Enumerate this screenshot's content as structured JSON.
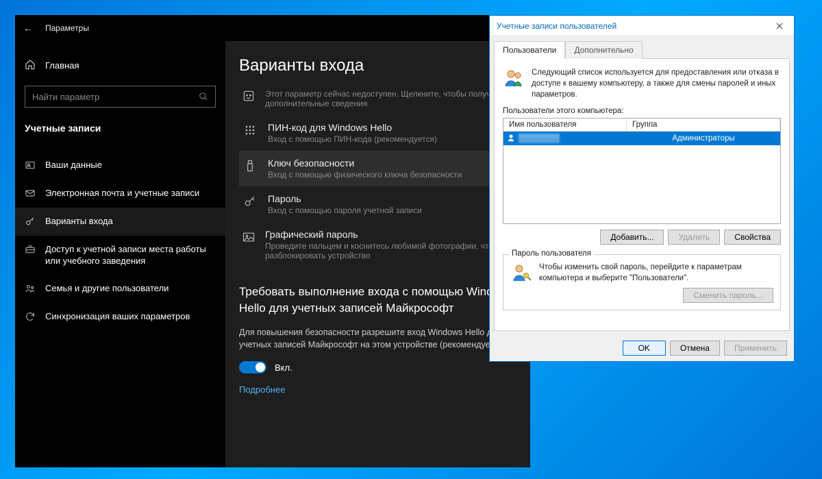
{
  "settings": {
    "title": "Параметры",
    "home": "Главная",
    "search_placeholder": "Найти параметр",
    "group": "Учетные записи",
    "items": [
      {
        "label": "Ваши данные",
        "icon": "user-card-icon"
      },
      {
        "label": "Электронная почта и учетные записи",
        "icon": "mail-icon"
      },
      {
        "label": "Варианты входа",
        "icon": "key-icon",
        "selected": true
      },
      {
        "label": "Доступ к учетной записи места работы или учебного заведения",
        "icon": "briefcase-icon"
      },
      {
        "label": "Семья и другие пользователи",
        "icon": "family-icon"
      },
      {
        "label": "Синхронизация ваших параметров",
        "icon": "sync-icon"
      }
    ]
  },
  "main": {
    "title": "Варианты входа",
    "topnote_desc": "Этот параметр сейчас недоступен. Щелкните, чтобы получить дополнительные сведения",
    "options": [
      {
        "title": "ПИН-код для Windows Hello",
        "desc": "Вход с помощью ПИН-кода (рекомендуется)",
        "icon": "pin-grid-icon"
      },
      {
        "title": "Ключ безопасности",
        "desc": "Вход с помощью физического ключа безопасности",
        "icon": "usb-icon",
        "selected": true
      },
      {
        "title": "Пароль",
        "desc": "Вход с помощью пароля учетной записи",
        "icon": "key-icon"
      },
      {
        "title": "Графический пароль",
        "desc": "Проведите пальцем и коснитесь любимой фотографии, чтобы разблокировать устройство",
        "icon": "picture-icon"
      }
    ],
    "section_title": "Требовать выполнение входа с помощью Windows Hello для учетных записей Майкрософт",
    "section_desc": "Для повышения безопасности разрешите вход Windows Hello для учетных записей Майкрософт на этом устройстве (рекомендуется)",
    "toggle_state": "Вкл.",
    "learn_more": "Подробнее"
  },
  "ua": {
    "title": "Учетные записи пользователей",
    "tabs": [
      "Пользователи",
      "Дополнительно"
    ],
    "header_text": "Следующий список используется для предоставления или отказа в доступе к вашему компьютеру, а также для смены паролей и иных параметров.",
    "list_label": "Пользователи этого компьютера:",
    "columns": {
      "user": "Имя пользователя",
      "group": "Группа"
    },
    "row_group": "Администраторы",
    "buttons": {
      "add": "Добавить...",
      "remove": "Удалить",
      "props": "Свойства"
    },
    "fieldset_title": "Пароль пользователя",
    "fieldset_text": "Чтобы изменить свой пароль, перейдите к параметрам компьютера и выберите \"Пользователи\".",
    "change_pw": "Сменить пароль...",
    "footer": {
      "ok": "OK",
      "cancel": "Отмена",
      "apply": "Применить"
    }
  }
}
